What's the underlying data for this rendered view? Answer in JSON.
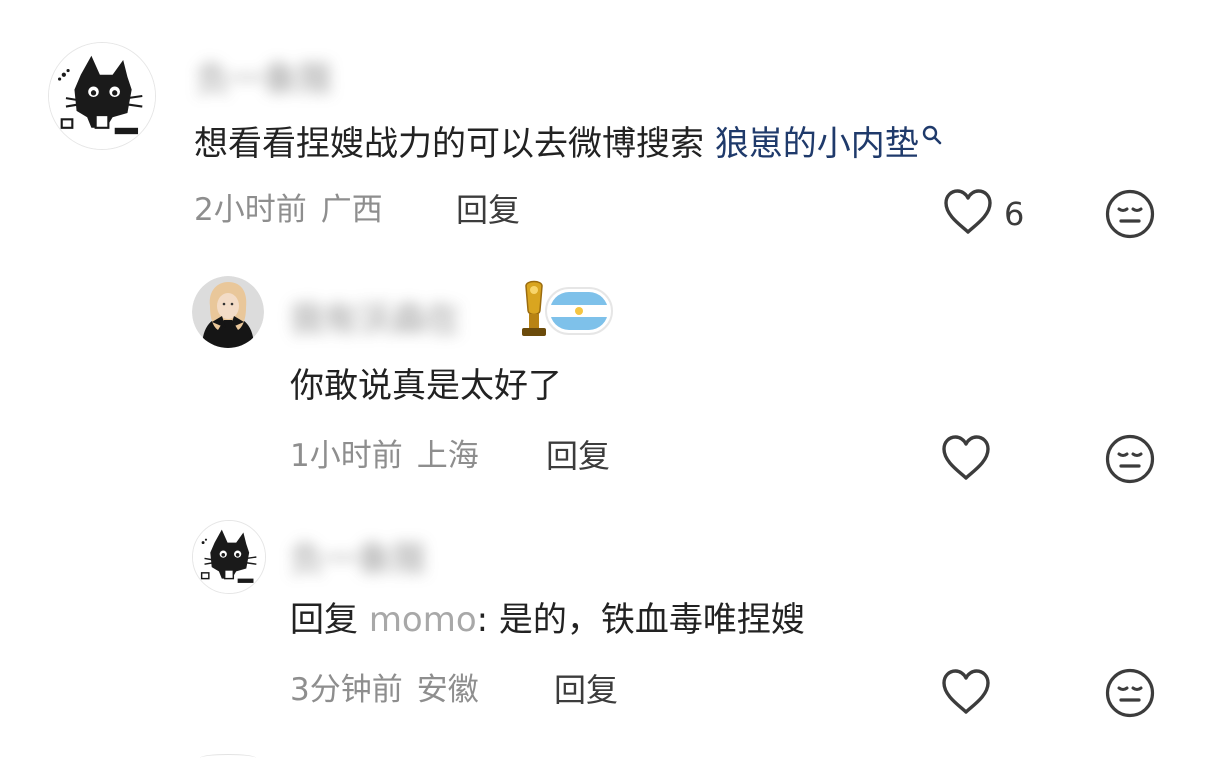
{
  "comments": [
    {
      "username": "负一象限",
      "text": "想看看捏嫂战力的可以去微博搜索 ",
      "link_text": "狼崽的小内垫",
      "time": "2小时前",
      "location": "广西",
      "reply_label": "回复",
      "like_count": "6"
    },
    {
      "username": "我有沃森在",
      "text": "你敢说真是太好了",
      "time": "1小时前",
      "location": "上海",
      "reply_label": "回复",
      "like_count": ""
    },
    {
      "username": "负一象限",
      "reply_prefix": "回复 ",
      "reply_to": "momo",
      "text": ": 是的，铁血毒唯捏嫂",
      "time": "3分钟前",
      "location": "安徽",
      "reply_label": "回复",
      "like_count": ""
    }
  ],
  "icons": {
    "like": "heart-outline-icon",
    "dislike": "neutral-face-icon",
    "search": "search-icon",
    "badge": "trophy-argentina-flag-badge"
  },
  "colors": {
    "link": "#1f3a6b",
    "meta": "#8e8e8e",
    "mention": "#a8a8a8"
  }
}
